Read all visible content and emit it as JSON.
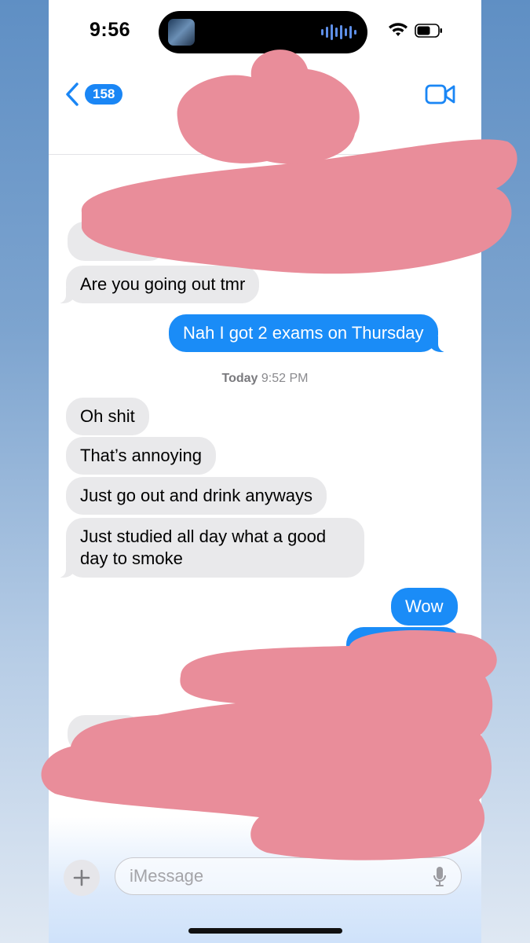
{
  "status_bar": {
    "time": "9:56"
  },
  "header": {
    "back_count": "158"
  },
  "messages": [
    {
      "direction": "incoming",
      "text": "Are you going out tmr"
    },
    {
      "direction": "outgoing",
      "text": "Nah I got 2 exams on Thursday"
    },
    {
      "direction": "incoming",
      "text": "Oh shit"
    },
    {
      "direction": "incoming",
      "text": "That’s annoying"
    },
    {
      "direction": "incoming",
      "text": "Just go out and drink anyways"
    },
    {
      "direction": "incoming",
      "text": "Just studied all day what a good day to smoke"
    },
    {
      "direction": "outgoing",
      "text": "Wow"
    }
  ],
  "timestamp": {
    "day": "Today",
    "time": "9:52 PM"
  },
  "composer": {
    "placeholder": "iMessage"
  },
  "colors": {
    "outgoing_bubble": "#1a8cf7",
    "incoming_bubble": "#e9e9eb",
    "badge": "#1a86f5",
    "redaction": "#e98d9a"
  },
  "icons": [
    "chevron-left-icon",
    "video-camera-icon",
    "wifi-icon",
    "battery-icon",
    "plus-icon",
    "microphone-icon",
    "waveform-icon"
  ]
}
